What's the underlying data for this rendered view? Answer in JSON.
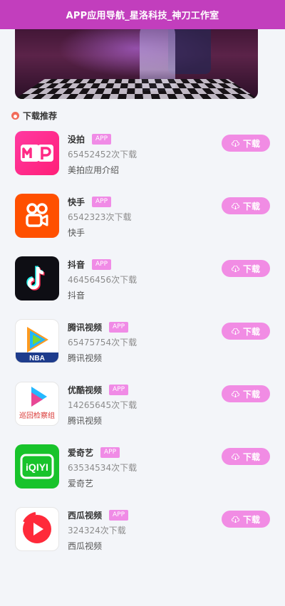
{
  "header": {
    "title": "APP应用导航_星洛科技_神刀工作室"
  },
  "section": {
    "title": "下载推荐"
  },
  "colors": {
    "header_bg": "#c23ebd",
    "accent_pink": "#f18ce4",
    "tag_pink": "#f08be6"
  },
  "apps": [
    {
      "name": "没拍",
      "tag": "APP",
      "downloads": "65452452次下载",
      "desc": "美拍应用介绍",
      "button": "下载",
      "icon": "meipai-icon"
    },
    {
      "name": "快手",
      "tag": "APP",
      "downloads": "6542323次下载",
      "desc": "快手",
      "button": "下载",
      "icon": "kuaishou-icon"
    },
    {
      "name": "抖音",
      "tag": "APP",
      "downloads": "46456456次下载",
      "desc": "抖音",
      "button": "下载",
      "icon": "douyin-icon"
    },
    {
      "name": "腾讯视频",
      "tag": "APP",
      "downloads": "65475754次下载",
      "desc": "腾讯视频",
      "button": "下载",
      "icon": "tencent-video-icon",
      "icon_text": "NBA"
    },
    {
      "name": "优酷视频",
      "tag": "APP",
      "downloads": "14265645次下载",
      "desc": "腾讯视频",
      "button": "下载",
      "icon": "youku-icon",
      "icon_text": "巡回检察组"
    },
    {
      "name": "爱奇艺",
      "tag": "APP",
      "downloads": "63534534次下载",
      "desc": "爱奇艺",
      "button": "下载",
      "icon": "iqiyi-icon",
      "icon_text": "iQIYI"
    },
    {
      "name": "西瓜视频",
      "tag": "APP",
      "downloads": "324324次下载",
      "desc": "西瓜视频",
      "button": "下载",
      "icon": "xigua-icon"
    }
  ]
}
